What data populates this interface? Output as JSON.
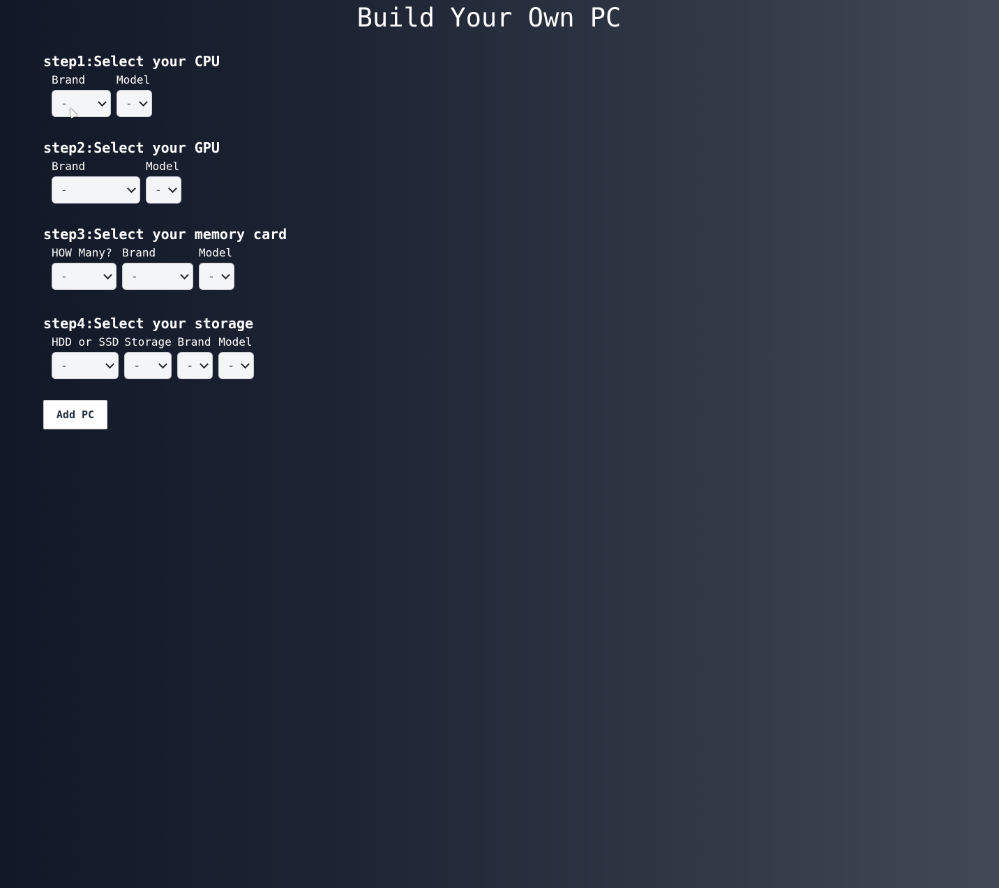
{
  "page": {
    "title": "Build Your Own PC"
  },
  "steps": [
    {
      "heading": "step1:Select your CPU",
      "fields": [
        {
          "label": "Brand",
          "value": "-"
        },
        {
          "label": "Model",
          "value": "-"
        }
      ]
    },
    {
      "heading": "step2:Select your GPU",
      "fields": [
        {
          "label": "Brand",
          "value": "-"
        },
        {
          "label": "Model",
          "value": "-"
        }
      ]
    },
    {
      "heading": "step3:Select your memory card",
      "fields": [
        {
          "label": "HOW Many?",
          "value": "-"
        },
        {
          "label": "Brand",
          "value": "-"
        },
        {
          "label": "Model",
          "value": "-"
        }
      ]
    },
    {
      "heading": "step4:Select your storage",
      "fields": [
        {
          "label": "HDD or SSD",
          "value": "-"
        },
        {
          "label": "Storage",
          "value": "-"
        },
        {
          "label": "Brand",
          "value": "-"
        },
        {
          "label": "Model",
          "value": "-"
        }
      ]
    }
  ],
  "actions": {
    "add_pc_label": "Add PC"
  },
  "colors": {
    "background_start": "#111827",
    "background_end": "#414954",
    "text": "#ffffff",
    "select_bg": "#f4f5f7"
  },
  "icons": {
    "select_arrow": "chevron-down-icon",
    "cursor": "mouse-pointer-icon"
  }
}
